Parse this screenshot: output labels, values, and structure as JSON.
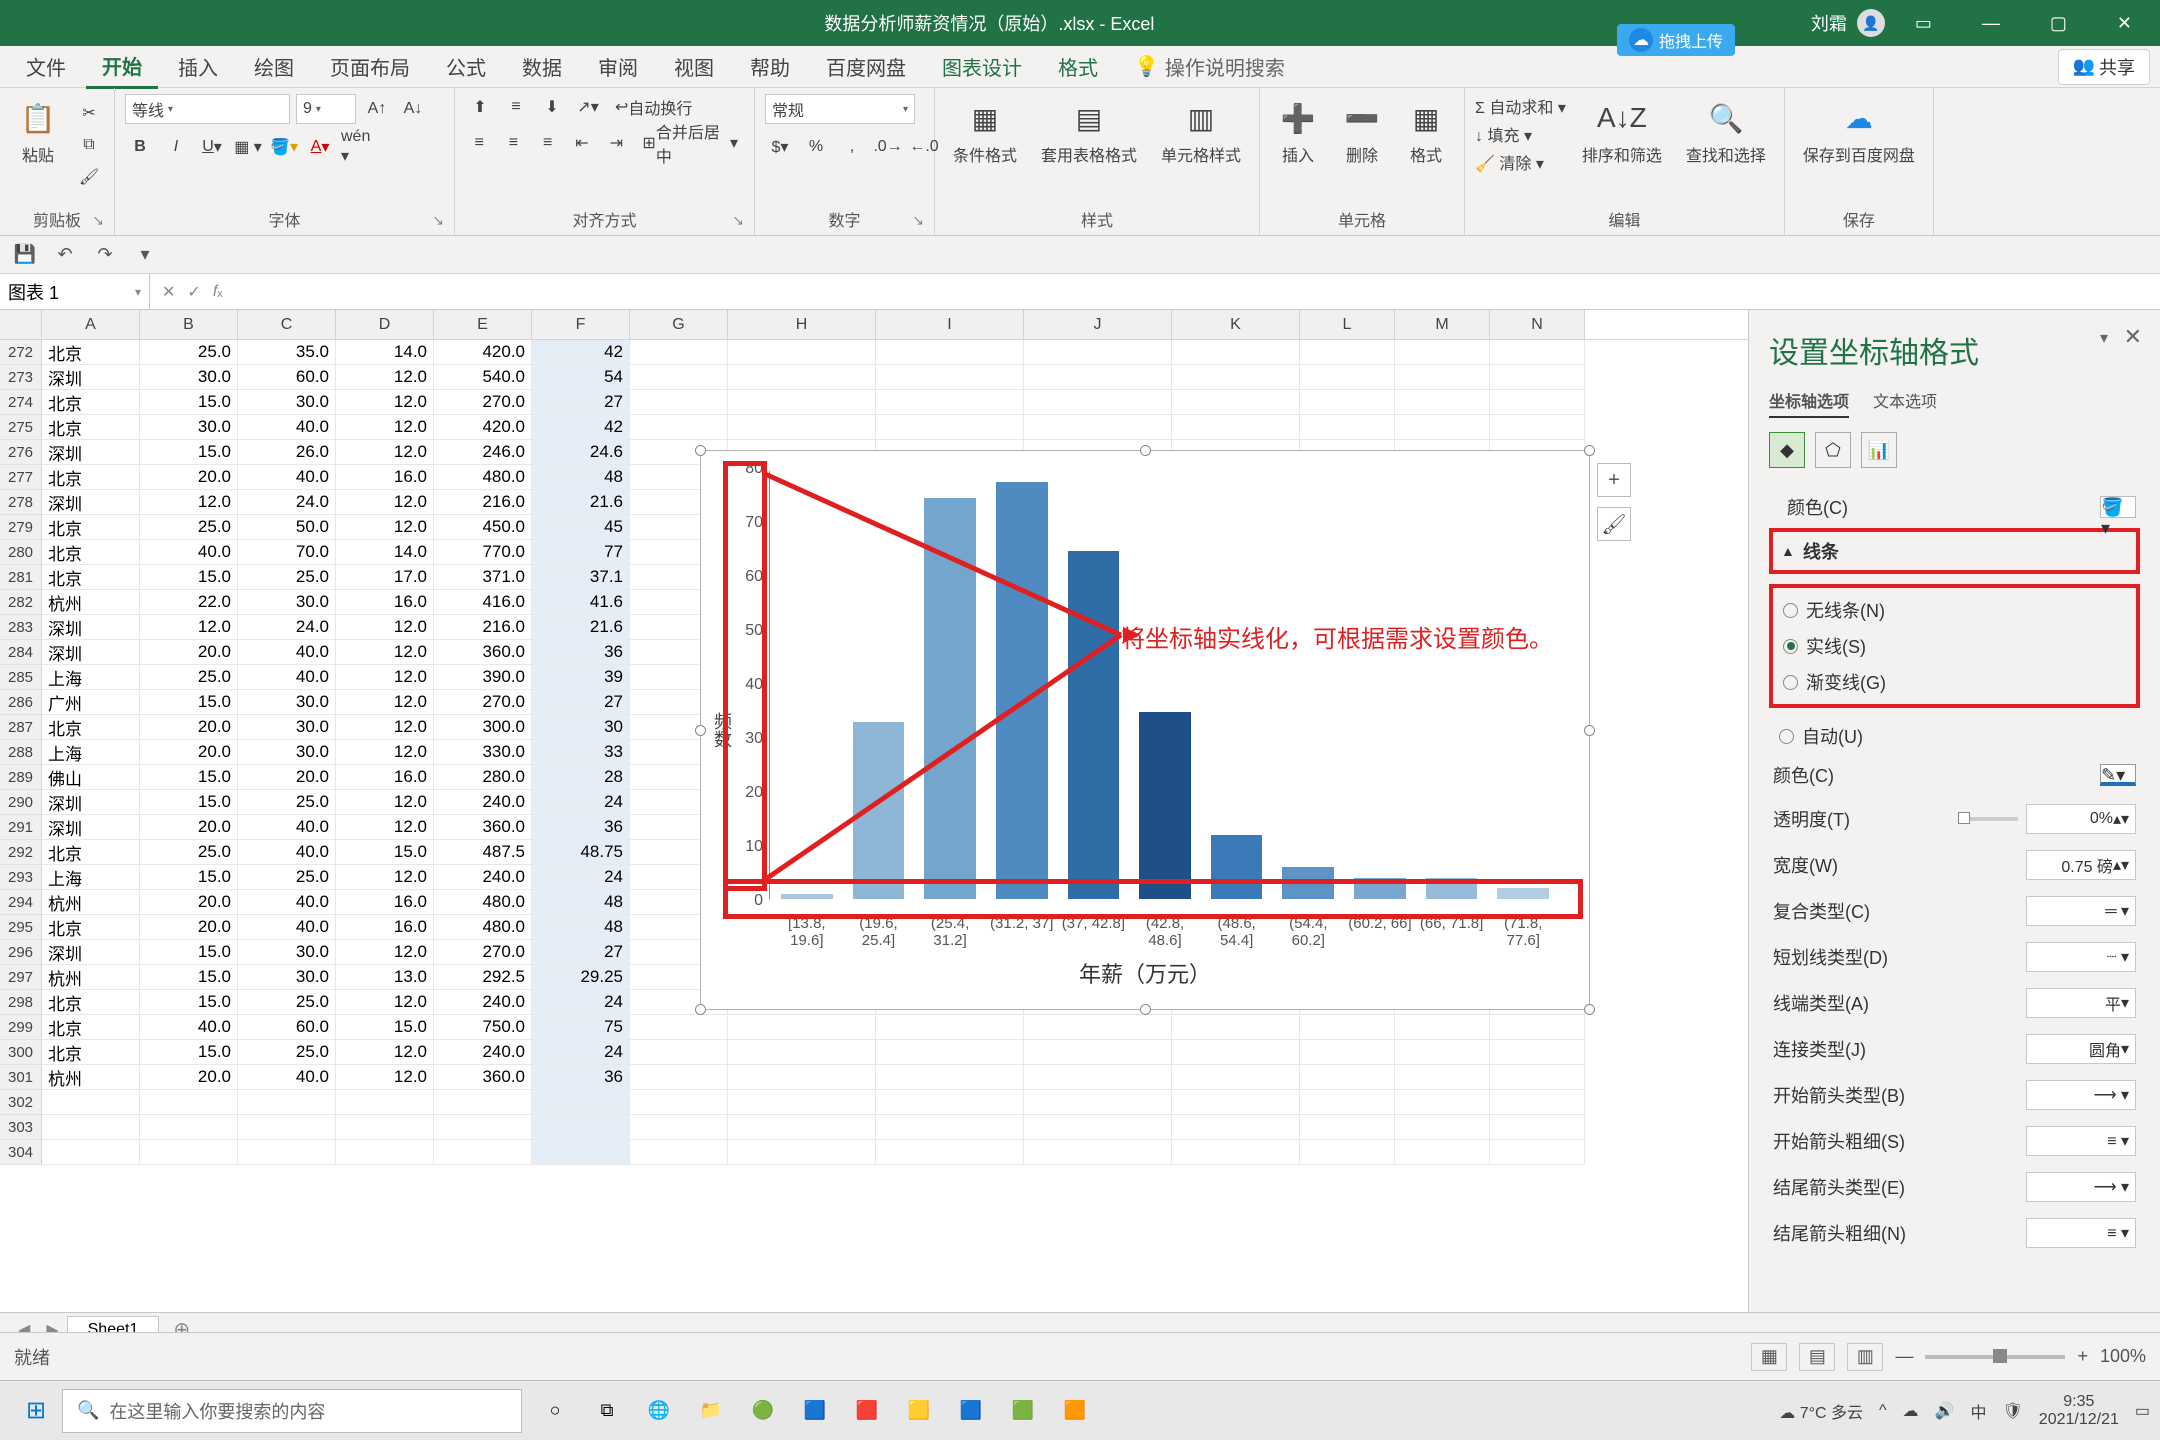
{
  "titlebar": {
    "filename": "数据分析师薪资情况（原始）.xlsx  -  Excel",
    "user": "刘霜",
    "upload": "拖拽上传"
  },
  "ribbon_tabs": {
    "file": "文件",
    "home": "开始",
    "insert": "插入",
    "draw": "绘图",
    "layout": "页面布局",
    "formulas": "公式",
    "data": "数据",
    "review": "审阅",
    "view": "视图",
    "help": "帮助",
    "baidu": "百度网盘",
    "chart_design": "图表设计",
    "format": "格式",
    "tell_me": "操作说明搜索",
    "share": "共享"
  },
  "ribbon_groups": {
    "clipboard": "剪贴板",
    "paste": "粘贴",
    "font": "字体",
    "font_name": "等线",
    "font_size": "9",
    "alignment": "对齐方式",
    "wrap": "自动换行",
    "merge": "合并后居中",
    "number": "数字",
    "number_fmt": "常规",
    "styles": "样式",
    "cond_fmt": "条件格式",
    "table_fmt": "套用表格格式",
    "cell_styles": "单元格样式",
    "cells": "单元格",
    "insert_c": "插入",
    "delete_c": "删除",
    "format_c": "格式",
    "editing": "编辑",
    "autosum": "自动求和",
    "fill": "填充",
    "clear": "清除",
    "sort": "排序和筛选",
    "find": "查找和选择",
    "save": "保存",
    "save_baidu": "保存到百度网盘"
  },
  "namebox": "图表 1",
  "columns": [
    "A",
    "B",
    "C",
    "D",
    "E",
    "F",
    "G",
    "H",
    "I",
    "J",
    "K",
    "L",
    "M",
    "N"
  ],
  "rows": [
    {
      "n": 272,
      "a": "北京",
      "b": "25.0",
      "c": "35.0",
      "d": "14.0",
      "e": "420.0",
      "f": "42"
    },
    {
      "n": 273,
      "a": "深圳",
      "b": "30.0",
      "c": "60.0",
      "d": "12.0",
      "e": "540.0",
      "f": "54"
    },
    {
      "n": 274,
      "a": "北京",
      "b": "15.0",
      "c": "30.0",
      "d": "12.0",
      "e": "270.0",
      "f": "27"
    },
    {
      "n": 275,
      "a": "北京",
      "b": "30.0",
      "c": "40.0",
      "d": "12.0",
      "e": "420.0",
      "f": "42"
    },
    {
      "n": 276,
      "a": "深圳",
      "b": "15.0",
      "c": "26.0",
      "d": "12.0",
      "e": "246.0",
      "f": "24.6"
    },
    {
      "n": 277,
      "a": "北京",
      "b": "20.0",
      "c": "40.0",
      "d": "16.0",
      "e": "480.0",
      "f": "48"
    },
    {
      "n": 278,
      "a": "深圳",
      "b": "12.0",
      "c": "24.0",
      "d": "12.0",
      "e": "216.0",
      "f": "21.6"
    },
    {
      "n": 279,
      "a": "北京",
      "b": "25.0",
      "c": "50.0",
      "d": "12.0",
      "e": "450.0",
      "f": "45"
    },
    {
      "n": 280,
      "a": "北京",
      "b": "40.0",
      "c": "70.0",
      "d": "14.0",
      "e": "770.0",
      "f": "77"
    },
    {
      "n": 281,
      "a": "北京",
      "b": "15.0",
      "c": "25.0",
      "d": "17.0",
      "e": "371.0",
      "f": "37.1"
    },
    {
      "n": 282,
      "a": "杭州",
      "b": "22.0",
      "c": "30.0",
      "d": "16.0",
      "e": "416.0",
      "f": "41.6"
    },
    {
      "n": 283,
      "a": "深圳",
      "b": "12.0",
      "c": "24.0",
      "d": "12.0",
      "e": "216.0",
      "f": "21.6"
    },
    {
      "n": 284,
      "a": "深圳",
      "b": "20.0",
      "c": "40.0",
      "d": "12.0",
      "e": "360.0",
      "f": "36"
    },
    {
      "n": 285,
      "a": "上海",
      "b": "25.0",
      "c": "40.0",
      "d": "12.0",
      "e": "390.0",
      "f": "39"
    },
    {
      "n": 286,
      "a": "广州",
      "b": "15.0",
      "c": "30.0",
      "d": "12.0",
      "e": "270.0",
      "f": "27"
    },
    {
      "n": 287,
      "a": "北京",
      "b": "20.0",
      "c": "30.0",
      "d": "12.0",
      "e": "300.0",
      "f": "30"
    },
    {
      "n": 288,
      "a": "上海",
      "b": "20.0",
      "c": "30.0",
      "d": "12.0",
      "e": "330.0",
      "f": "33"
    },
    {
      "n": 289,
      "a": "佛山",
      "b": "15.0",
      "c": "20.0",
      "d": "16.0",
      "e": "280.0",
      "f": "28"
    },
    {
      "n": 290,
      "a": "深圳",
      "b": "15.0",
      "c": "25.0",
      "d": "12.0",
      "e": "240.0",
      "f": "24"
    },
    {
      "n": 291,
      "a": "深圳",
      "b": "20.0",
      "c": "40.0",
      "d": "12.0",
      "e": "360.0",
      "f": "36"
    },
    {
      "n": 292,
      "a": "北京",
      "b": "25.0",
      "c": "40.0",
      "d": "15.0",
      "e": "487.5",
      "f": "48.75"
    },
    {
      "n": 293,
      "a": "上海",
      "b": "15.0",
      "c": "25.0",
      "d": "12.0",
      "e": "240.0",
      "f": "24"
    },
    {
      "n": 294,
      "a": "杭州",
      "b": "20.0",
      "c": "40.0",
      "d": "16.0",
      "e": "480.0",
      "f": "48"
    },
    {
      "n": 295,
      "a": "北京",
      "b": "20.0",
      "c": "40.0",
      "d": "16.0",
      "e": "480.0",
      "f": "48"
    },
    {
      "n": 296,
      "a": "深圳",
      "b": "15.0",
      "c": "30.0",
      "d": "12.0",
      "e": "270.0",
      "f": "27"
    },
    {
      "n": 297,
      "a": "杭州",
      "b": "15.0",
      "c": "30.0",
      "d": "13.0",
      "e": "292.5",
      "f": "29.25"
    },
    {
      "n": 298,
      "a": "北京",
      "b": "15.0",
      "c": "25.0",
      "d": "12.0",
      "e": "240.0",
      "f": "24"
    },
    {
      "n": 299,
      "a": "北京",
      "b": "40.0",
      "c": "60.0",
      "d": "15.0",
      "e": "750.0",
      "f": "75"
    },
    {
      "n": 300,
      "a": "北京",
      "b": "15.0",
      "c": "25.0",
      "d": "12.0",
      "e": "240.0",
      "f": "24"
    },
    {
      "n": 301,
      "a": "杭州",
      "b": "20.0",
      "c": "40.0",
      "d": "12.0",
      "e": "360.0",
      "f": "36"
    },
    {
      "n": 302,
      "a": "",
      "b": "",
      "c": "",
      "d": "",
      "e": "",
      "f": ""
    },
    {
      "n": 303,
      "a": "",
      "b": "",
      "c": "",
      "d": "",
      "e": "",
      "f": ""
    },
    {
      "n": 304,
      "a": "",
      "b": "",
      "c": "",
      "d": "",
      "e": "",
      "f": ""
    }
  ],
  "sheet": {
    "name": "Sheet1"
  },
  "status": {
    "ready": "就绪",
    "zoom": "100%"
  },
  "side": {
    "title": "设置坐标轴格式",
    "axis_opts": "坐标轴选项",
    "text_opts": "文本选项",
    "color_c": "颜色(C)",
    "line": "线条",
    "no_line": "无线条(N)",
    "solid": "实线(S)",
    "gradient": "渐变线(G)",
    "auto": "自动(U)",
    "color2": "颜色(C)",
    "transparency": "透明度(T)",
    "transparency_v": "0%",
    "width": "宽度(W)",
    "width_v": "0.75 磅",
    "compound": "复合类型(C)",
    "dash": "短划线类型(D)",
    "cap": "线端类型(A)",
    "cap_v": "平",
    "join": "连接类型(J)",
    "join_v": "圆角",
    "begin_arrow": "开始箭头类型(B)",
    "begin_size": "开始箭头粗细(S)",
    "end_arrow": "结尾箭头类型(E)",
    "end_size": "结尾箭头粗细(N)"
  },
  "annotation": "将坐标轴实线化，可根据需求设置颜色。",
  "chart_data": {
    "type": "bar",
    "title": "",
    "xlabel": "年薪（万元）",
    "ylabel": "频数",
    "ylim": [
      0,
      80
    ],
    "yticks": [
      0,
      10,
      20,
      30,
      40,
      50,
      60,
      70,
      80
    ],
    "categories": [
      "[13.8, 19.6]",
      "(19.6, 25.4]",
      "(25.4, 31.2]",
      "(31.2, 37]",
      "(37, 42.8]",
      "(42.8, 48.6]",
      "(48.6, 54.4]",
      "(54.4, 60.2]",
      "(60.2, 66]",
      "(66, 71.8]",
      "(71.8, 77.6]"
    ],
    "values": [
      1,
      33,
      75,
      78,
      65,
      35,
      12,
      6,
      4,
      4,
      2
    ],
    "colors": [
      "#a8c5e0",
      "#8db6d7",
      "#74a5cc",
      "#4f8bc0",
      "#2e6da5",
      "#1f4e88",
      "#3b7ab8",
      "#5e93c6",
      "#7aa7d1",
      "#97bbda",
      "#b3cee3"
    ]
  },
  "taskbar": {
    "search_ph": "在这里输入你要搜索的内容",
    "weather": "7°C 多云",
    "ime": "中",
    "time": "9:35",
    "date": "2021/12/21"
  }
}
